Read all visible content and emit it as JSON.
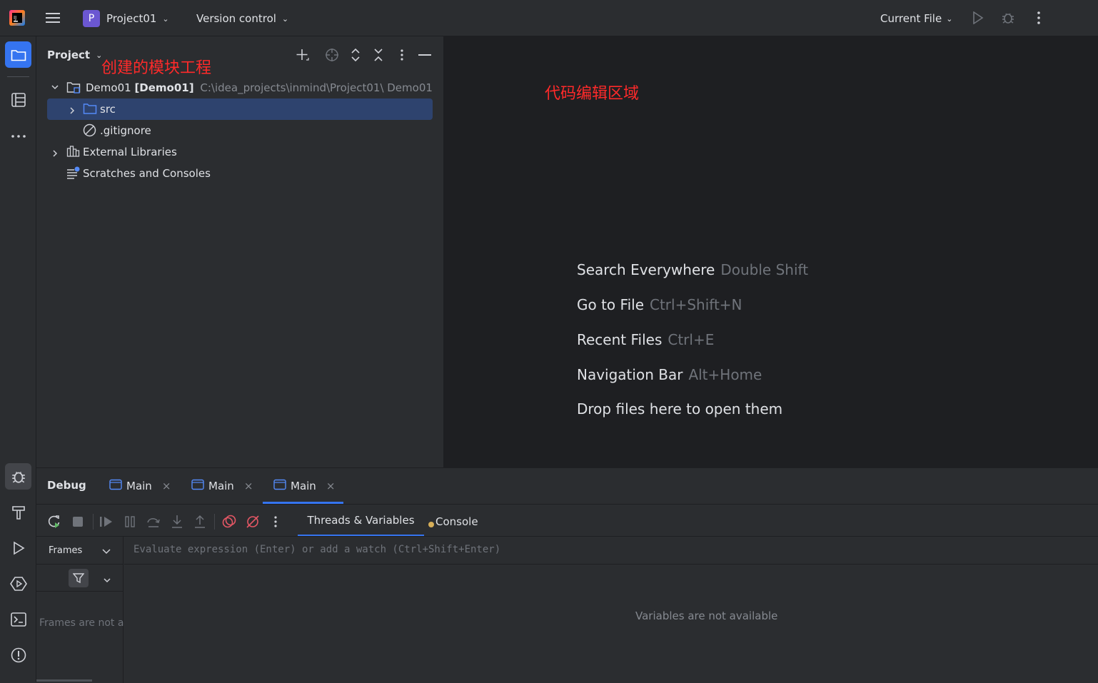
{
  "titlebar": {
    "project_letter": "P",
    "project_name": "Project01",
    "vcs_label": "Version control",
    "run_config": "Current File"
  },
  "project_panel": {
    "title": "Project",
    "annotation": "创建的模块工程",
    "tree": [
      {
        "name": "Demo01",
        "bold": "[Demo01]",
        "path": "C:\\idea_projects\\inmind\\Project01\\ Demo01"
      },
      {
        "name": "src"
      },
      {
        "name": ".gitignore"
      },
      {
        "name": "External Libraries"
      },
      {
        "name": "Scratches and Consoles"
      }
    ]
  },
  "editor": {
    "annotation": "代码编辑区域",
    "hints": [
      {
        "label": "Search Everywhere",
        "key": "Double Shift"
      },
      {
        "label": "Go to File",
        "key": "Ctrl+Shift+N"
      },
      {
        "label": "Recent Files",
        "key": "Ctrl+E"
      },
      {
        "label": "Navigation Bar",
        "key": "Alt+Home"
      },
      {
        "label": "Drop files here to open them",
        "key": ""
      }
    ]
  },
  "debug": {
    "title": "Debug",
    "tabs": [
      "Main",
      "Main",
      "Main"
    ],
    "subtabs": [
      "Threads & Variables",
      "Console"
    ],
    "frames_label": "Frames",
    "frames_empty": "Frames are not a",
    "eval_placeholder": "Evaluate expression (Enter) or add a watch (Ctrl+Shift+Enter)",
    "variables_empty": "Variables are not available"
  },
  "colors": {
    "accent": "#3574f0",
    "annotation_red": "#ff2a2a",
    "selection": "#2e436e"
  }
}
